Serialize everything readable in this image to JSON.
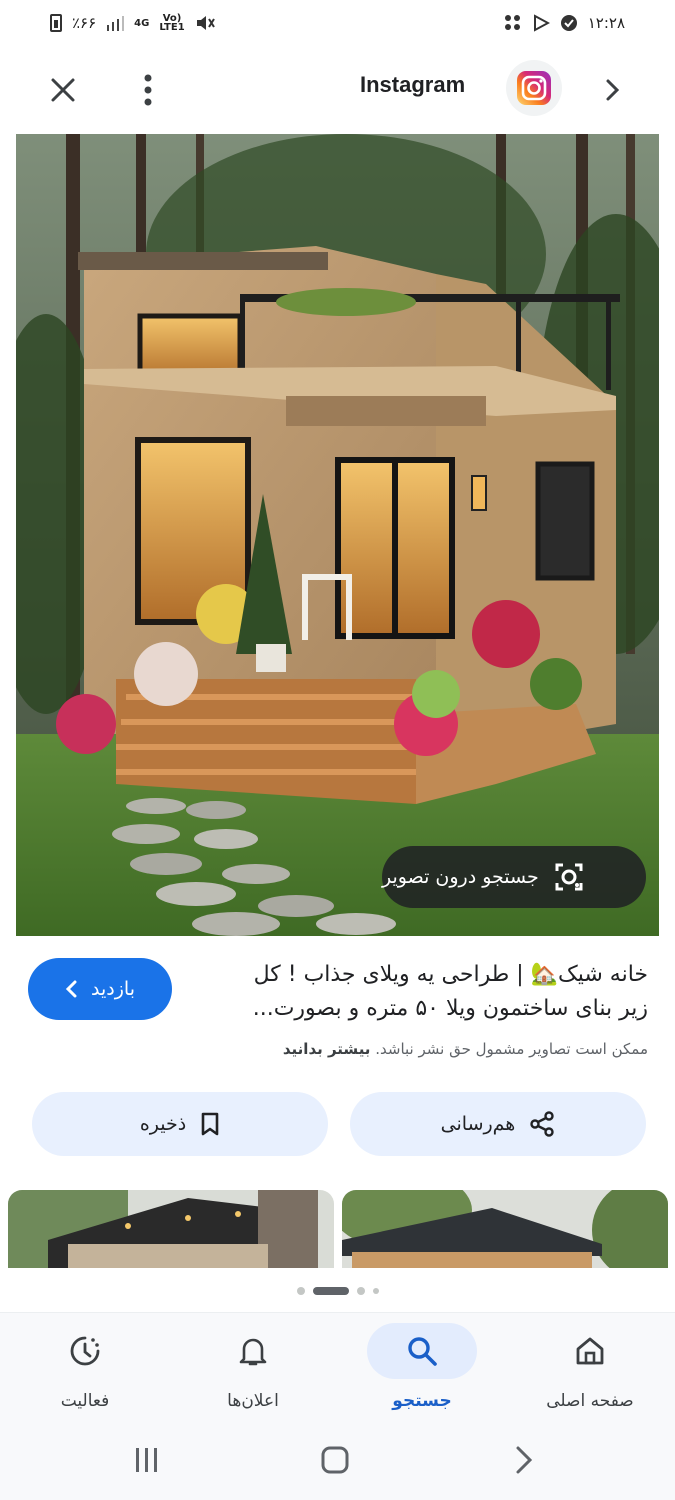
{
  "status_bar": {
    "time": "۱۲:۲۸",
    "battery": "٪۶۶",
    "network_top": "4G",
    "network_bottom": "Vo)",
    "network_lte": "LTE1"
  },
  "app_bar": {
    "source_title": "Instagram"
  },
  "image": {
    "lens_label": "جستجو درون تصویر"
  },
  "result": {
    "caption_line1": "خانه شیک🏡 | طراحی یه ویلای جذاب ! کل",
    "caption_line2": "زیر بنای ساختمون ویلا ۵۰ متره و بصورت...",
    "copyright_text": "ممکن است تصاویر مشمول حق نشر نباشد.",
    "learn_more": "بیشتر بدانید",
    "visit_label": "بازدید",
    "share_label": "هم‌رسانی",
    "save_label": "ذخیره"
  },
  "bottom_nav": {
    "home": "صفحه اصلی",
    "search": "جستجو",
    "notifications": "اعلان‌ها",
    "activity": "فعالیت"
  },
  "colors": {
    "accent": "#1a73e8",
    "chip_bg": "#e8f0fe"
  }
}
